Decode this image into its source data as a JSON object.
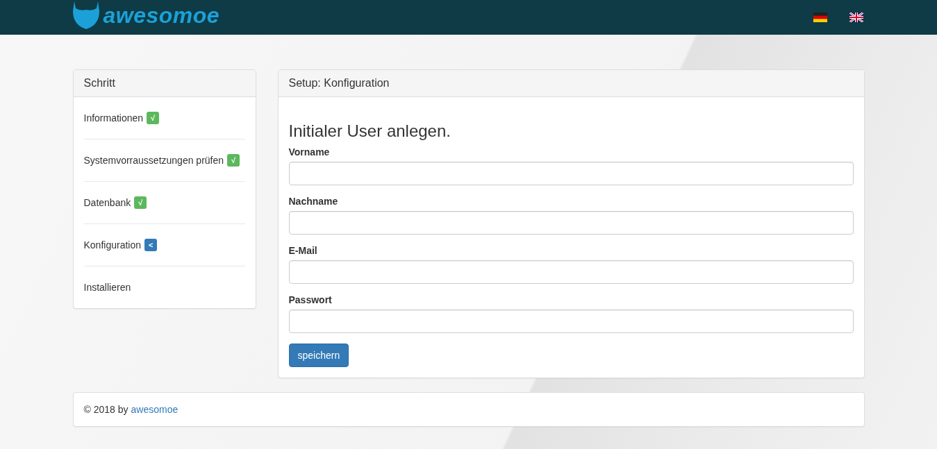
{
  "header": {
    "logo_text": "awesomoe",
    "languages": [
      {
        "kind": "de",
        "selected": false
      },
      {
        "kind": "en",
        "selected": false
      }
    ]
  },
  "steps_panel": {
    "title": "Schritt",
    "steps": [
      {
        "label": "Informationen",
        "kind": "done",
        "badge": "√"
      },
      {
        "label": "Systemvorraussetzungen prüfen",
        "kind": "done",
        "badge": "√"
      },
      {
        "label": "Datenbank",
        "kind": "done",
        "badge": "√"
      },
      {
        "label": "Konfiguration",
        "kind": "current",
        "badge": "<"
      },
      {
        "label": "Installieren",
        "kind": "pending"
      }
    ]
  },
  "setup_panel": {
    "title": "Setup: Konfiguration",
    "heading": "Initialer User anlegen.",
    "fields": [
      {
        "label": "Vorname"
      },
      {
        "label": "Nachname"
      },
      {
        "label": "E-Mail"
      },
      {
        "label": "Passwort"
      }
    ],
    "submit": "speichern"
  },
  "footer": {
    "text": "© 2018 by",
    "link": "awesomoe"
  }
}
